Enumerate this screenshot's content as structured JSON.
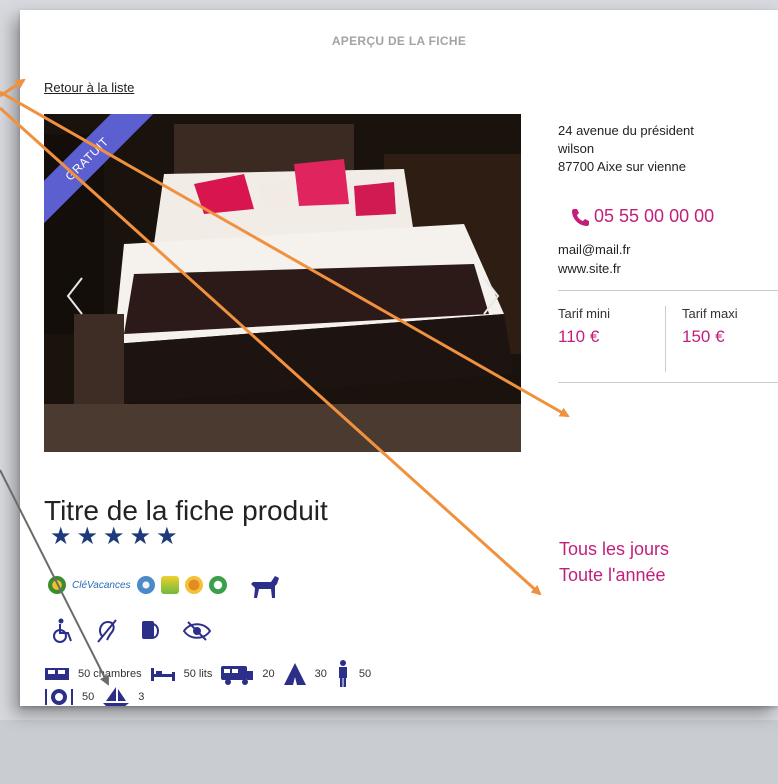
{
  "header": {
    "title": "APERÇU DE LA FICHE"
  },
  "nav": {
    "back_link": "Retour à la liste"
  },
  "gallery": {
    "ribbon": "GRATUIT"
  },
  "contact": {
    "address_line1": "24 avenue du président",
    "address_line2": "wilson",
    "address_line3": "87700 Aixe sur vienne",
    "phone": "05 55 00 00 00",
    "email": "mail@mail.fr",
    "website": "www.site.fr"
  },
  "pricing": {
    "min_label": "Tarif mini",
    "min_value": "110 €",
    "max_label": "Tarif maxi",
    "max_value": "150 €"
  },
  "product": {
    "title": "Titre de la fiche produit",
    "stars": 5,
    "labels": {
      "clevacances": "CléVacances"
    },
    "capacity": {
      "rooms": "50 chambres",
      "beds": "50 lits",
      "campers": "20",
      "tents": "30",
      "persons": "50",
      "meals": "50",
      "boats": "3"
    }
  },
  "availability": {
    "line1": "Tous les jours",
    "line2": "Toute l'année"
  },
  "colors": {
    "accent": "#c21f7b",
    "ribbon": "#5b5fd0",
    "star": "#1e3a7b",
    "icon": "#2b2f8a",
    "arrow": "#f0913f",
    "grey_arrow": "#6b6b6b"
  }
}
